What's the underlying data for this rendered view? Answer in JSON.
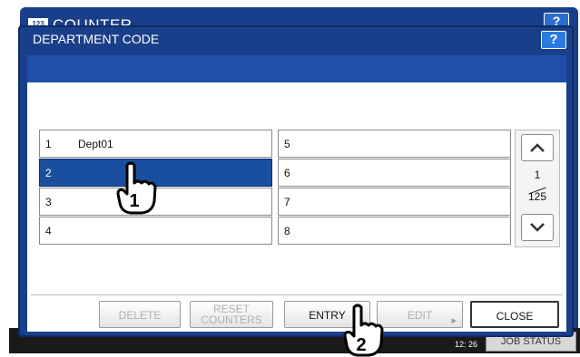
{
  "background_window": {
    "title": "COUNTER",
    "title_icon_text": "123",
    "help_label": "?",
    "clock": "12: 26",
    "job_status_label": "JOB STATUS"
  },
  "dialog": {
    "title": "DEPARTMENT CODE",
    "help_label": "?"
  },
  "list": {
    "left_column": [
      {
        "num": "1",
        "name": "Dept01",
        "selected": false
      },
      {
        "num": "2",
        "name": "",
        "selected": true
      },
      {
        "num": "3",
        "name": "",
        "selected": false
      },
      {
        "num": "4",
        "name": "",
        "selected": false
      }
    ],
    "right_column": [
      {
        "num": "5",
        "name": ""
      },
      {
        "num": "6",
        "name": ""
      },
      {
        "num": "7",
        "name": ""
      },
      {
        "num": "8",
        "name": ""
      }
    ]
  },
  "pager": {
    "current_page": "1",
    "total_pages": "125",
    "up_icon": "chevron-up-icon",
    "down_icon": "chevron-down-icon"
  },
  "buttons": {
    "delete": "DELETE",
    "reset_counters_line1": "RESET",
    "reset_counters_line2": "COUNTERS",
    "entry": "ENTRY",
    "edit": "EDIT",
    "close": "CLOSE"
  },
  "annotations": {
    "step1": "1",
    "step2": "2"
  },
  "colors": {
    "title_bar": "#1a3f8a",
    "selected_row": "#1a4fa0",
    "disabled_text": "#b0b0b0"
  }
}
